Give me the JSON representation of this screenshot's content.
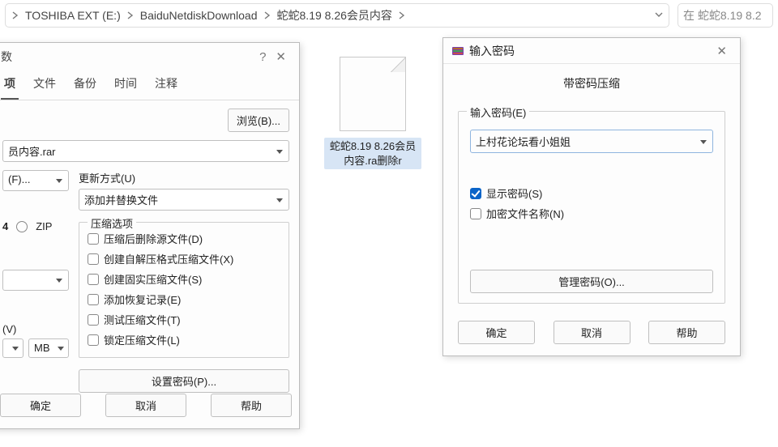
{
  "breadcrumb": {
    "items": [
      "TOSHIBA EXT (E:)",
      "BaiduNetdiskDownload",
      "蛇蛇8.19 8.26会员内容"
    ],
    "search_placeholder": "在 蛇蛇8.19 8.2"
  },
  "file": {
    "caption": "蛇蛇8.19 8.26会员内容.ra删除r"
  },
  "dlg1": {
    "title_suffix": "数",
    "tabs": [
      "项",
      "文件",
      "备份",
      "时间",
      "注释"
    ],
    "browse_btn": "浏览(B)...",
    "archive_name": "员内容.rar",
    "update_lbl": "更新方式(U)",
    "update_val": "添加并替换文件",
    "fmt_left": "(F)...",
    "fmt_rar4": "4",
    "fmt_zip": "ZIP",
    "compress_legend": "压缩选项",
    "opts": [
      "压缩后删除源文件(D)",
      "创建自解压格式压缩文件(X)",
      "创建固实压缩文件(S)",
      "添加恢复记录(E)",
      "测试压缩文件(T)",
      "锁定压缩文件(L)"
    ],
    "split_lbl": "(V)",
    "split_unit": "MB",
    "set_pw_btn": "设置密码(P)...",
    "ok": "确定",
    "cancel": "取消",
    "help": "帮助"
  },
  "dlg2": {
    "title": "输入密码",
    "subtitle": "带密码压缩",
    "pw_lbl": "输入密码(E)",
    "pw_val": "上村花论坛看小姐姐",
    "show_pw": "显示密码(S)",
    "encrypt_names": "加密文件名称(N)",
    "manage_btn": "管理密码(O)...",
    "ok": "确定",
    "cancel": "取消",
    "help": "帮助"
  }
}
